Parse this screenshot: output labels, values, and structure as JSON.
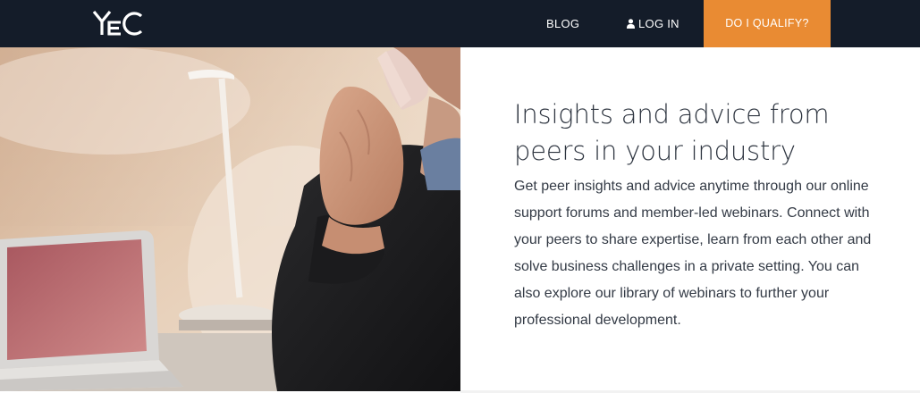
{
  "nav": {
    "logo_text": "YEC",
    "blog_label": "BLOG",
    "login_label": "LOG IN",
    "login_icon": "user-icon",
    "cta_label": "DO I QUALIFY?"
  },
  "hero": {
    "headline": "Insights and advice from peers in your industry",
    "body": "Get peer insights and advice anytime through our online support forums and member-led webinars. Connect with your peers to share expertise, learn from each other and solve business challenges in a private setting. You can also explore our library of webinars to further your professional development."
  },
  "colors": {
    "nav_bg": "#141c29",
    "cta_bg": "#e98b33",
    "text": "#333a45"
  }
}
